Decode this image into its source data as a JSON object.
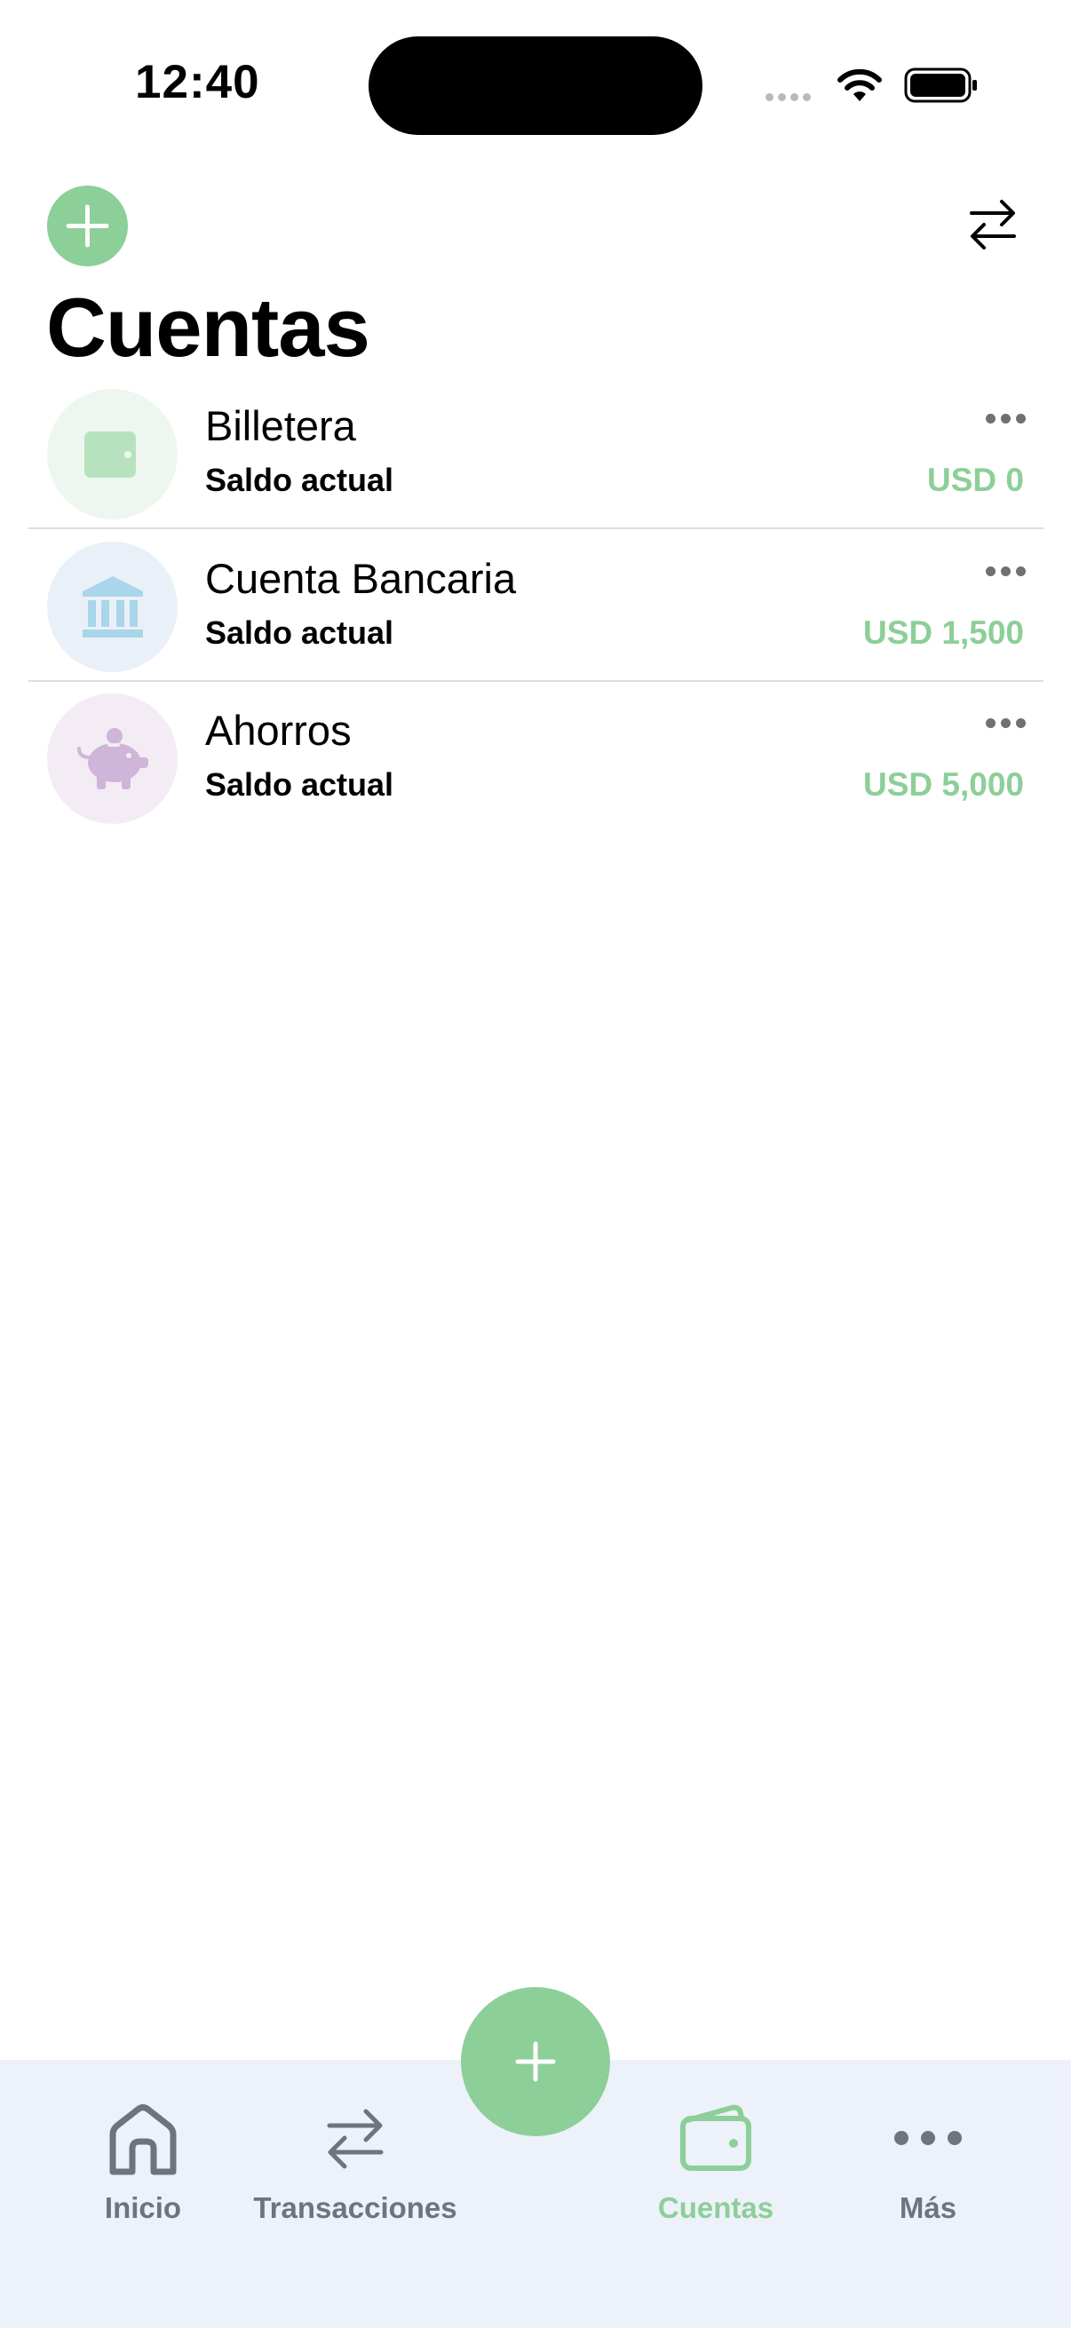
{
  "status_bar": {
    "time": "12:40"
  },
  "header": {
    "title": "Cuentas"
  },
  "accounts": [
    {
      "name": "Billetera",
      "label": "Saldo actual",
      "balance": "USD 0",
      "icon": "wallet-icon"
    },
    {
      "name": "Cuenta Bancaria",
      "label": "Saldo actual",
      "balance": "USD 1,500",
      "icon": "bank-icon"
    },
    {
      "name": "Ahorros",
      "label": "Saldo actual",
      "balance": "USD 5,000",
      "icon": "piggy-bank-icon"
    }
  ],
  "tabbar": {
    "items": [
      {
        "label": "Inicio",
        "icon": "home-icon",
        "active": false
      },
      {
        "label": "Transacciones",
        "icon": "transfer-icon",
        "active": false
      },
      {
        "label": "Cuentas",
        "icon": "wallet-icon",
        "active": true
      },
      {
        "label": "Más",
        "icon": "more-icon",
        "active": false
      }
    ]
  },
  "colors": {
    "accent": "#8ccf98",
    "wallet_bg": "#edf7ef",
    "bank_bg": "#eaf0f8",
    "savings_bg": "#f3ecf5",
    "tabbar_bg": "#edf1f9"
  }
}
